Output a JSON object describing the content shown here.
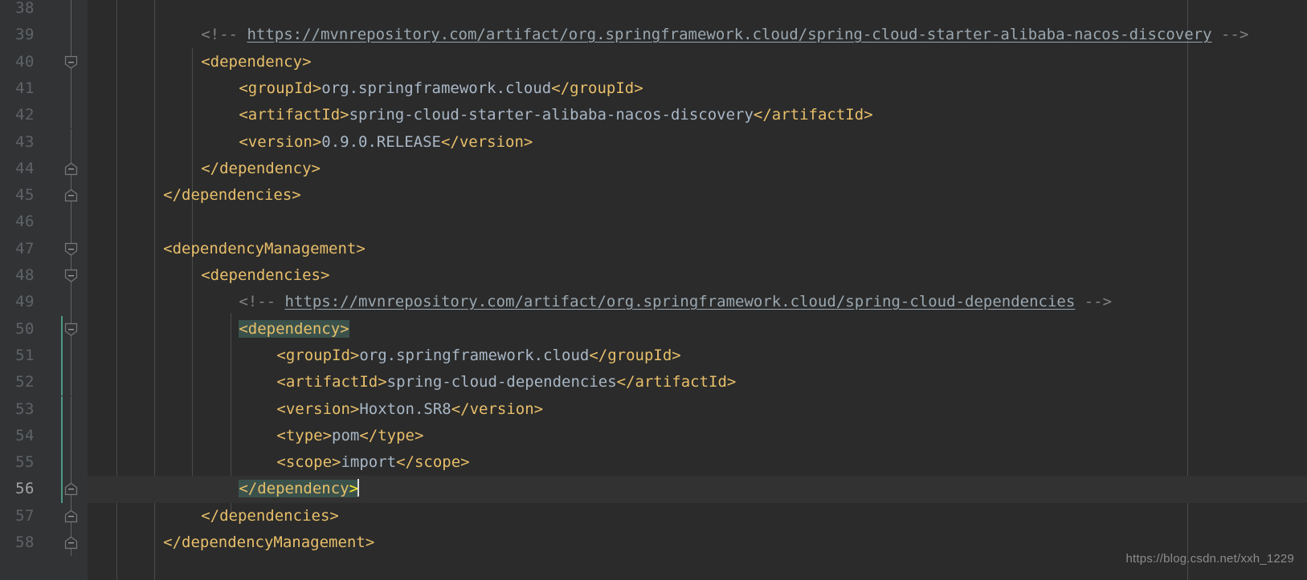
{
  "editor": {
    "theme_name": "darcula",
    "colors": {
      "background": "#2b2b2b",
      "gutter_background": "#313335",
      "line_number": "#606366",
      "current_line_number": "#a4a3a3",
      "current_line_background": "#323232",
      "tag": "#e8bf6a",
      "text_value": "#a9b7c6",
      "comment": "#808080",
      "link": "#9aa7b0",
      "brace_highlight_background": "#3b524c",
      "brace_match_foreground": "#ffef28",
      "indent_guide": "#4b4b4b",
      "change_bar": "#4e9a84",
      "caret": "#dcdcdc"
    },
    "first_visible_line": 38,
    "last_visible_line": 58,
    "current_line": 56,
    "caret_line": 56,
    "caret_column": 25,
    "lines": [
      {
        "number": "38",
        "indent": 0,
        "current": false,
        "fold": "rail",
        "change": false,
        "segments": []
      },
      {
        "number": "39",
        "indent": 3,
        "current": false,
        "fold": "rail",
        "change": false,
        "segments": [
          {
            "kind": "cmt",
            "text": "<!-- "
          },
          {
            "kind": "link",
            "text": "https://mvnrepository.com/artifact/org.springframework.cloud/spring-cloud-starter-alibaba-nacos-discovery"
          },
          {
            "kind": "cmt",
            "text": " -->"
          }
        ]
      },
      {
        "number": "40",
        "indent": 3,
        "current": false,
        "fold": "start",
        "change": false,
        "segments": [
          {
            "kind": "tag",
            "text": "<dependency>"
          }
        ]
      },
      {
        "number": "41",
        "indent": 4,
        "current": false,
        "fold": "rail",
        "change": false,
        "segments": [
          {
            "kind": "tag",
            "text": "<groupId>"
          },
          {
            "kind": "val",
            "text": "org.springframework.cloud"
          },
          {
            "kind": "tag",
            "text": "</groupId>"
          }
        ]
      },
      {
        "number": "42",
        "indent": 4,
        "current": false,
        "fold": "rail",
        "change": false,
        "segments": [
          {
            "kind": "tag",
            "text": "<artifactId>"
          },
          {
            "kind": "val",
            "text": "spring-cloud-starter-alibaba-nacos-discovery"
          },
          {
            "kind": "tag",
            "text": "</artifactId>"
          }
        ]
      },
      {
        "number": "43",
        "indent": 4,
        "current": false,
        "fold": "rail",
        "change": false,
        "segments": [
          {
            "kind": "tag",
            "text": "<version>"
          },
          {
            "kind": "val",
            "text": "0.9.0.RELEASE"
          },
          {
            "kind": "tag",
            "text": "</version>"
          }
        ]
      },
      {
        "number": "44",
        "indent": 3,
        "current": false,
        "fold": "end",
        "change": false,
        "segments": [
          {
            "kind": "tag",
            "text": "</dependency>"
          }
        ]
      },
      {
        "number": "45",
        "indent": 2,
        "current": false,
        "fold": "end",
        "change": false,
        "segments": [
          {
            "kind": "tag",
            "text": "</dependencies>"
          }
        ]
      },
      {
        "number": "46",
        "indent": 0,
        "current": false,
        "fold": "rail",
        "change": false,
        "segments": []
      },
      {
        "number": "47",
        "indent": 2,
        "current": false,
        "fold": "start",
        "change": false,
        "segments": [
          {
            "kind": "tag",
            "text": "<dependencyManagement>"
          }
        ]
      },
      {
        "number": "48",
        "indent": 3,
        "current": false,
        "fold": "start",
        "change": false,
        "segments": [
          {
            "kind": "tag",
            "text": "<dependencies>"
          }
        ]
      },
      {
        "number": "49",
        "indent": 4,
        "current": false,
        "fold": "rail",
        "change": false,
        "segments": [
          {
            "kind": "cmt",
            "text": "<!-- "
          },
          {
            "kind": "link",
            "text": "https://mvnrepository.com/artifact/org.springframework.cloud/spring-cloud-dependencies"
          },
          {
            "kind": "cmt",
            "text": " -->"
          }
        ]
      },
      {
        "number": "50",
        "indent": 4,
        "current": false,
        "fold": "start",
        "change": true,
        "segments": [
          {
            "kind": "tag hl",
            "text": "<dependency>"
          }
        ]
      },
      {
        "number": "51",
        "indent": 5,
        "current": false,
        "fold": "rail",
        "change": true,
        "segments": [
          {
            "kind": "tag",
            "text": "<groupId>"
          },
          {
            "kind": "val",
            "text": "org.springframework.cloud"
          },
          {
            "kind": "tag",
            "text": "</groupId>"
          }
        ]
      },
      {
        "number": "52",
        "indent": 5,
        "current": false,
        "fold": "rail",
        "change": true,
        "segments": [
          {
            "kind": "tag",
            "text": "<artifactId>"
          },
          {
            "kind": "val",
            "text": "spring-cloud-dependencies"
          },
          {
            "kind": "tag",
            "text": "</artifactId>"
          }
        ]
      },
      {
        "number": "53",
        "indent": 5,
        "current": false,
        "fold": "rail",
        "change": true,
        "segments": [
          {
            "kind": "tag",
            "text": "<version>"
          },
          {
            "kind": "val",
            "text": "Hoxton.SR8"
          },
          {
            "kind": "tag",
            "text": "</version>"
          }
        ]
      },
      {
        "number": "54",
        "indent": 5,
        "current": false,
        "fold": "rail",
        "change": true,
        "segments": [
          {
            "kind": "tag",
            "text": "<type>"
          },
          {
            "kind": "val",
            "text": "pom"
          },
          {
            "kind": "tag",
            "text": "</type>"
          }
        ]
      },
      {
        "number": "55",
        "indent": 5,
        "current": false,
        "fold": "rail",
        "change": true,
        "segments": [
          {
            "kind": "tag",
            "text": "<scope>"
          },
          {
            "kind": "val",
            "text": "import"
          },
          {
            "kind": "tag",
            "text": "</scope>"
          }
        ]
      },
      {
        "number": "56",
        "indent": 4,
        "current": true,
        "fold": "end",
        "change": true,
        "caret": true,
        "segments": [
          {
            "kind": "tag hl",
            "text": "</dependency"
          },
          {
            "kind": "brace-match hl",
            "text": ">"
          }
        ]
      },
      {
        "number": "57",
        "indent": 3,
        "current": false,
        "fold": "end",
        "change": false,
        "segments": [
          {
            "kind": "tag",
            "text": "</dependencies>"
          }
        ]
      },
      {
        "number": "58",
        "indent": 2,
        "current": false,
        "fold": "end",
        "change": false,
        "segments": [
          {
            "kind": "tag",
            "text": "</dependencyManagement>"
          }
        ]
      }
    ],
    "indent_guide_columns": [
      3,
      7,
      11,
      15
    ],
    "right_margin_column": 120
  },
  "watermark": {
    "text": "https://blog.csdn.net/xxh_1229"
  }
}
